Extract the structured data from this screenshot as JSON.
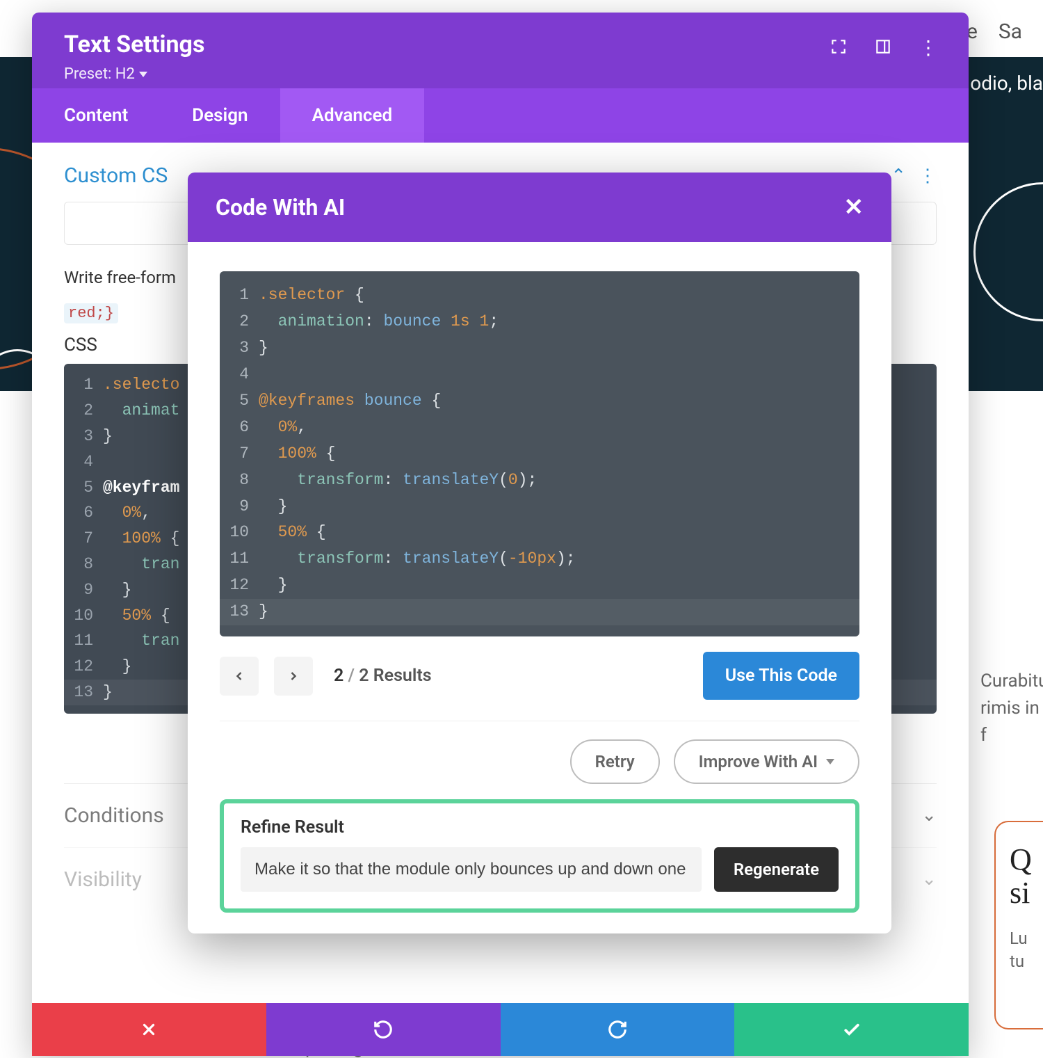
{
  "bg": {
    "nav_items": [
      "ple",
      "Sa"
    ],
    "dark_text": "odio, bla",
    "body_snippet1": "Curabitu",
    "body_snippet2": "rimis in f",
    "card_title": "Q si",
    "card_body1": "Lu",
    "card_body2": "tu",
    "bottom_text": "consectetur adipiscing elit              sem interdum faucibus  In"
  },
  "modal": {
    "title": "Text Settings",
    "preset_label": "Preset: H2",
    "tabs": [
      "Content",
      "Design",
      "Advanced"
    ],
    "active_tab_index": 2,
    "section_title": "Custom CS",
    "help_text_prefix": "Write free-form",
    "code_chip": "red;}",
    "css_label": "CSS",
    "code_lines": [
      {
        "n": "1",
        "html": "<span class='tok-sel'>.selecto</span>"
      },
      {
        "n": "2",
        "html": "&nbsp;&nbsp;<span class='tok-prop'>animat</span>"
      },
      {
        "n": "3",
        "html": "<span class='tok-punc'>}</span>"
      },
      {
        "n": "4",
        "html": ""
      },
      {
        "n": "5",
        "html": "<span class='tok-bkey'>@keyfram</span>"
      },
      {
        "n": "6",
        "html": "&nbsp;&nbsp;<span class='tok-pct'>0%</span><span class='tok-punc'>,</span>"
      },
      {
        "n": "7",
        "html": "&nbsp;&nbsp;<span class='tok-pct'>100%</span> <span class='tok-punc'>{</span>"
      },
      {
        "n": "8",
        "html": "&nbsp;&nbsp;&nbsp;&nbsp;<span class='tok-prop'>tran</span>"
      },
      {
        "n": "9",
        "html": "&nbsp;&nbsp;<span class='tok-punc'>}</span>"
      },
      {
        "n": "10",
        "html": "&nbsp;&nbsp;<span class='tok-pct'>50%</span> <span class='tok-punc'>{</span>"
      },
      {
        "n": "11",
        "html": "&nbsp;&nbsp;&nbsp;&nbsp;<span class='tok-prop'>tran</span>"
      },
      {
        "n": "12",
        "html": "&nbsp;&nbsp;<span class='tok-punc'>}</span>"
      },
      {
        "n": "13",
        "html": "<span class='tok-punc'>}</span>",
        "hl": true
      }
    ],
    "accordions": [
      {
        "title": "Conditions"
      },
      {
        "title": "Visibility"
      }
    ]
  },
  "footer": {
    "close": "✕",
    "undo": "↺",
    "redo": "↻",
    "check": "✓"
  },
  "ai": {
    "title": "Code With AI",
    "code_lines": [
      {
        "n": "1",
        "html": "<span class='tok-sel'>.selector</span> <span class='tok-punc'>{</span>"
      },
      {
        "n": "2",
        "html": "&nbsp;&nbsp;<span class='tok-prop'>animation</span><span class='tok-punc'>:</span> <span class='tok-name'>bounce</span> <span class='tok-num'>1s</span> <span class='tok-num'>1</span><span class='tok-punc'>;</span>"
      },
      {
        "n": "3",
        "html": "<span class='tok-punc'>}</span>"
      },
      {
        "n": "4",
        "html": ""
      },
      {
        "n": "5",
        "html": "<span class='tok-sel'>@keyframes</span> <span class='tok-name'>bounce</span> <span class='tok-punc'>{</span>"
      },
      {
        "n": "6",
        "html": "&nbsp;&nbsp;<span class='tok-pct'>0%</span><span class='tok-punc'>,</span>"
      },
      {
        "n": "7",
        "html": "&nbsp;&nbsp;<span class='tok-pct'>100%</span> <span class='tok-punc'>{</span>"
      },
      {
        "n": "8",
        "html": "&nbsp;&nbsp;&nbsp;&nbsp;<span class='tok-prop'>transform</span><span class='tok-punc'>:</span> <span class='tok-fn'>translateY</span><span class='tok-punc'>(</span><span class='tok-num'>0</span><span class='tok-punc'>);</span>"
      },
      {
        "n": "9",
        "html": "&nbsp;&nbsp;<span class='tok-punc'>}</span>"
      },
      {
        "n": "10",
        "html": "&nbsp;&nbsp;<span class='tok-pct'>50%</span> <span class='tok-punc'>{</span>"
      },
      {
        "n": "11",
        "html": "&nbsp;&nbsp;&nbsp;&nbsp;<span class='tok-prop'>transform</span><span class='tok-punc'>:</span> <span class='tok-fn'>translateY</span><span class='tok-punc'>(</span><span class='tok-num'>-10px</span><span class='tok-punc'>);</span>"
      },
      {
        "n": "12",
        "html": "&nbsp;&nbsp;<span class='tok-punc'>}</span>"
      },
      {
        "n": "13",
        "html": "<span class='tok-punc'>}</span>",
        "hl": true
      }
    ],
    "pager_current": "2",
    "pager_sep": " / ",
    "pager_total": "2 Results",
    "use_button": "Use This Code",
    "retry": "Retry",
    "improve": "Improve With AI",
    "refine_title": "Refine Result",
    "refine_value": "Make it so that the module only bounces up and down one",
    "regenerate": "Regenerate"
  }
}
